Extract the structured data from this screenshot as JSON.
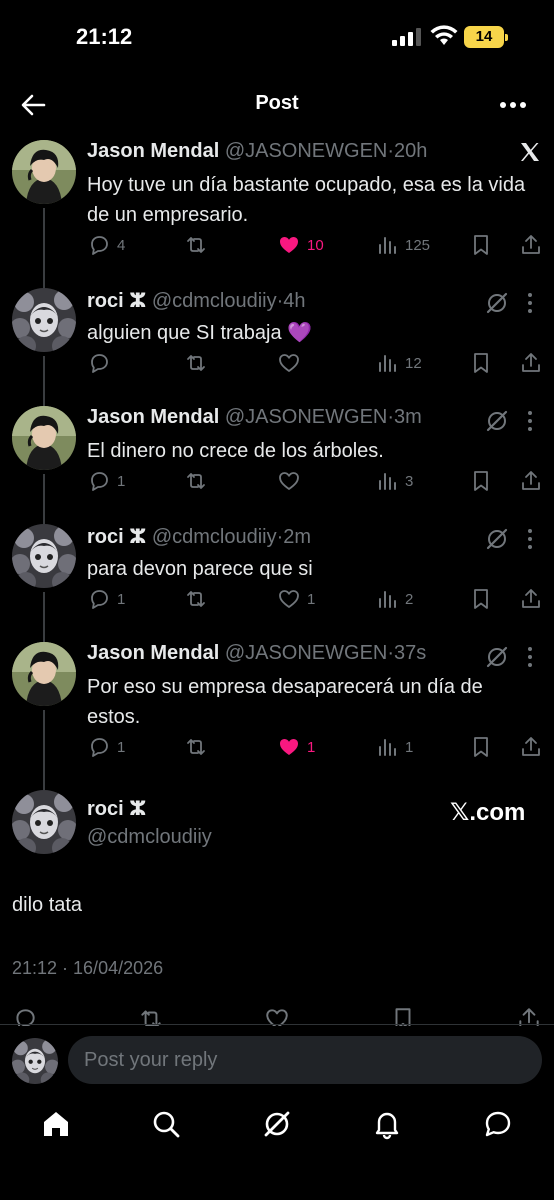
{
  "status_bar": {
    "time": "21:12",
    "battery": "14"
  },
  "header": {
    "title": "Post"
  },
  "thread": [
    {
      "name": "Jason Mendal",
      "handle": "@JASONEWGEN",
      "age": "20h",
      "text": "Hoy tuve un día bastante ocupado, esa es la vida de un empresario.",
      "replies": "4",
      "retweets": "",
      "likes": "10",
      "liked": true,
      "views": "125"
    },
    {
      "name": "roci ⵣ",
      "handle": "@cdmcloudiiy",
      "age": "4h",
      "text": "alguien que SI trabaja 💜",
      "replies": "",
      "retweets": "",
      "likes": "",
      "liked": false,
      "views": "12"
    },
    {
      "name": "Jason Mendal",
      "handle": "@JASONEWGEN",
      "age": "3m",
      "text": "El dinero no crece de los árboles.",
      "replies": "1",
      "retweets": "",
      "likes": "",
      "liked": false,
      "views": "3"
    },
    {
      "name": "roci ⵣ",
      "handle": "@cdmcloudiiy",
      "age": "2m",
      "text": "para devon parece que si",
      "replies": "1",
      "retweets": "",
      "likes": "1",
      "liked": false,
      "views": "2"
    },
    {
      "name": "Jason Mendal",
      "handle": "@JASONEWGEN",
      "age": "37s",
      "text": "Por eso su empresa desaparecerá un día de estos.",
      "replies": "1",
      "retweets": "",
      "likes": "1",
      "liked": true,
      "views": "1"
    }
  ],
  "main_post": {
    "name": "roci ⵣ",
    "handle": "@cdmcloudiiy",
    "source_label": "𝕏.com",
    "text": "dilo tata",
    "timestamp": "21:12 · 16/04/2026"
  },
  "reply": {
    "placeholder": "Post your reply"
  },
  "icons": [
    "back-arrow-icon",
    "more-icon",
    "x-logo-icon",
    "grok-icon",
    "reply-icon",
    "retweet-icon",
    "heart-icon",
    "views-icon",
    "bookmark-icon",
    "share-icon",
    "home-icon",
    "search-icon",
    "grok-nav-icon",
    "bell-icon",
    "messages-icon"
  ],
  "colors": {
    "background": "#000000",
    "text": "#e7e9ea",
    "muted": "#71767b",
    "like": "#f91880",
    "battery": "#f7d54a"
  }
}
